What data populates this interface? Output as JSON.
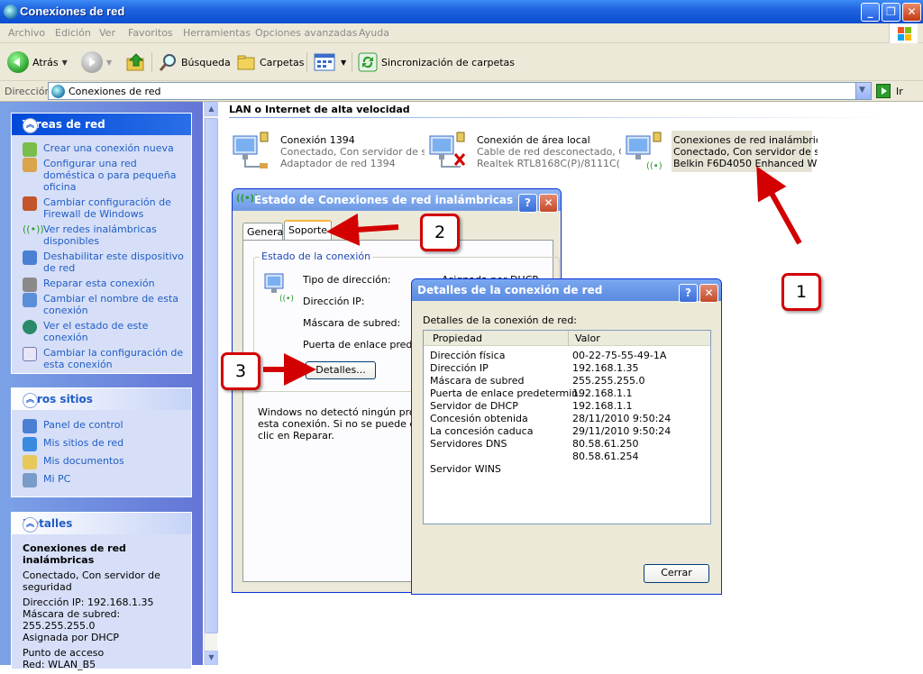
{
  "window": {
    "title": "Conexiones de red"
  },
  "menu": [
    "Archivo",
    "Edición",
    "Ver",
    "Favoritos",
    "Herramientas",
    "Opciones avanzadas",
    "Ayuda"
  ],
  "toolbar": {
    "back": "Atrás",
    "search": "Búsqueda",
    "folders": "Carpetas",
    "sync": "Sincronización de carpetas"
  },
  "address": {
    "label": "Dirección",
    "value": "Conexiones de red",
    "go": "Ir"
  },
  "sidebar": {
    "tasks": {
      "title": "Tareas de red",
      "items": [
        "Crear una conexión nueva",
        "Configurar una red doméstica o para pequeña oficina",
        "Cambiar configuración de Firewall de Windows",
        "Ver redes inalámbricas disponibles",
        "Deshabilitar este dispositivo de red",
        "Reparar esta conexión",
        "Cambiar el nombre de esta conexión",
        "Ver el estado de este conexión",
        "Cambiar la configuración de esta conexión"
      ]
    },
    "other": {
      "title": "Otros sitios",
      "items": [
        "Panel de control",
        "Mis sitios de red",
        "Mis documentos",
        "Mi PC"
      ]
    },
    "details": {
      "title": "Detalles",
      "name": "Conexiones de red inalámbricas",
      "status": "Conectado, Con servidor de seguridad",
      "ip": "Dirección IP: 192.168.1.35",
      "mask": "Máscara de subred: 255.255.255.0",
      "assigned": "Asignada por DHCP",
      "ap_label": "Punto de acceso",
      "ap": "Red: WLAN_B5"
    }
  },
  "group": {
    "title": "LAN o Internet de alta velocidad"
  },
  "connections": [
    {
      "name": "Conexión 1394",
      "status": "Conectado, Con servidor de s...",
      "device": "Adaptador de red 1394"
    },
    {
      "name": "Conexión de área local",
      "status": "Cable de red desconectado, C...",
      "device": "Realtek RTL8168C(P)/8111C(..."
    },
    {
      "name": "Conexiones de red inalámbricas",
      "status": "Conectado, Con servidor de s...",
      "device": "Belkin F6D4050 Enhanced Wir..."
    }
  ],
  "status_dialog": {
    "title": "Estado de Conexiones de red inalámbricas",
    "tabs": [
      "General",
      "Soporte"
    ],
    "group_title": "Estado de la conexión",
    "labels": [
      "Tipo de dirección:",
      "Dirección IP:",
      "Máscara de subred:",
      "Puerta de enlace pred.:"
    ],
    "address_type": "Asignada por DHCP",
    "details_button": "Detalles...",
    "repair_text_1": "Windows no detectó ningún problem",
    "repair_text_2": "esta conexión. Si no se puede cone",
    "repair_text_3": "clic en Reparar."
  },
  "details_dialog": {
    "title": "Detalles de la conexión de red",
    "subtitle": "Detalles de la conexión de red:",
    "col_property": "Propiedad",
    "col_value": "Valor",
    "rows": [
      {
        "p": "Dirección física",
        "v": "00-22-75-55-49-1A"
      },
      {
        "p": "Dirección IP",
        "v": "192.168.1.35"
      },
      {
        "p": "Máscara de subred",
        "v": "255.255.255.0"
      },
      {
        "p": "Puerta de enlace predetermin...",
        "v": "192.168.1.1"
      },
      {
        "p": "Servidor de DHCP",
        "v": "192.168.1.1"
      },
      {
        "p": "Concesión obtenida",
        "v": "28/11/2010 9:50:24"
      },
      {
        "p": "La concesión caduca",
        "v": "29/11/2010 9:50:24"
      },
      {
        "p": "Servidores DNS",
        "v": "80.58.61.250"
      },
      {
        "p": "",
        "v": "80.58.61.254"
      },
      {
        "p": "Servidor WINS",
        "v": ""
      }
    ],
    "close_button": "Cerrar"
  },
  "callouts": [
    "1",
    "2",
    "3"
  ]
}
